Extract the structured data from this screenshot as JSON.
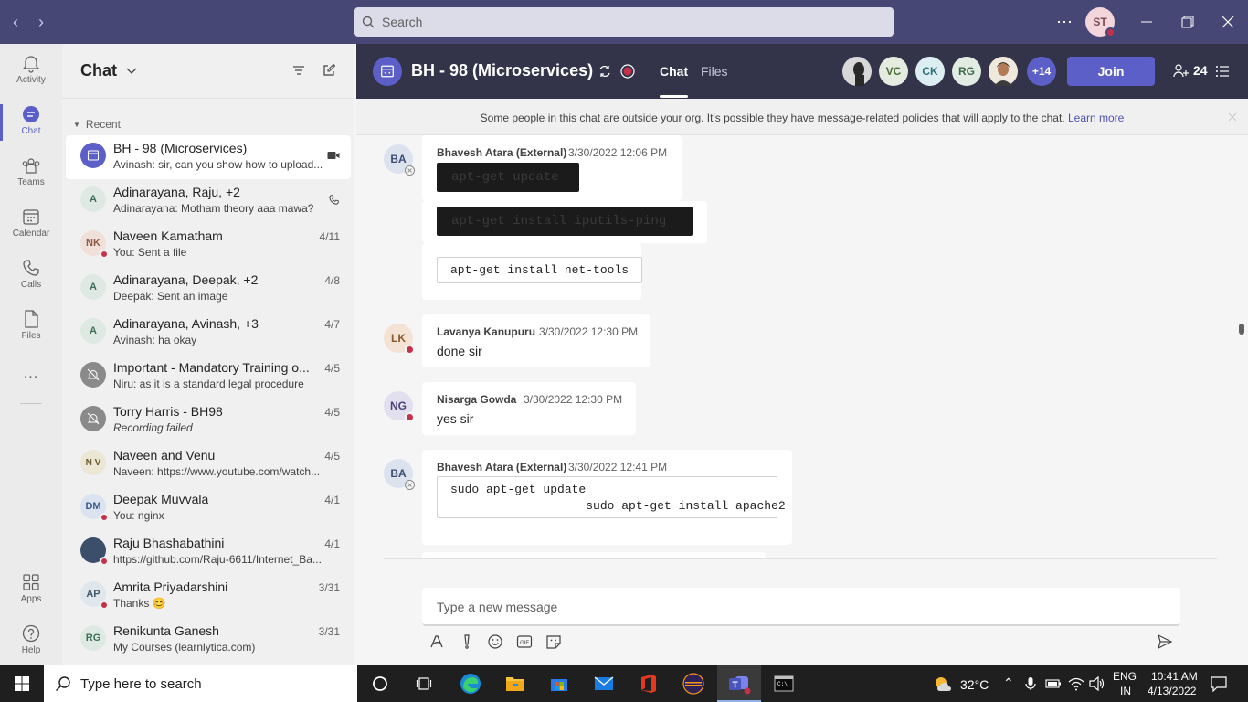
{
  "titlebar": {
    "search_placeholder": "Search",
    "user_initials": "ST"
  },
  "rail": {
    "items": [
      {
        "label": "Activity",
        "icon": "bell-icon"
      },
      {
        "label": "Chat",
        "icon": "chat-icon"
      },
      {
        "label": "Teams",
        "icon": "teams-icon"
      },
      {
        "label": "Calendar",
        "icon": "calendar-icon"
      },
      {
        "label": "Calls",
        "icon": "phone-icon"
      },
      {
        "label": "Files",
        "icon": "file-icon"
      },
      {
        "label": "Apps",
        "icon": "apps-icon"
      },
      {
        "label": "Help",
        "icon": "help-icon"
      }
    ],
    "more": "..."
  },
  "chatlist": {
    "title": "Chat",
    "recent_label": "Recent",
    "items": [
      {
        "name": "BH - 98 (Microservices)",
        "preview": "Avinash: sir, can you show how to upload...",
        "date": "",
        "avatar": ""
      },
      {
        "name": "Adinarayana, Raju, +2",
        "preview": "Adinarayana: Motham theory aaa mawa?",
        "date": "",
        "avatar": "A"
      },
      {
        "name": "Naveen Kamatham",
        "preview": "You: Sent a file",
        "date": "4/11",
        "avatar": "NK"
      },
      {
        "name": "Adinarayana, Deepak, +2",
        "preview": "Deepak: Sent an image",
        "date": "4/8",
        "avatar": "A"
      },
      {
        "name": "Adinarayana, Avinash, +3",
        "preview": "Avinash: ha okay",
        "date": "4/7",
        "avatar": "A"
      },
      {
        "name": "Important - Mandatory Training o...",
        "preview": "Niru: as it is a standard legal procedure",
        "date": "4/5",
        "avatar": ""
      },
      {
        "name": "Torry Harris - BH98",
        "preview": "Recording failed",
        "date": "4/5",
        "avatar": ""
      },
      {
        "name": "Naveen and Venu",
        "preview": "Naveen: https://www.youtube.com/watch...",
        "date": "4/5",
        "avatar": "N V"
      },
      {
        "name": "Deepak Muvvala",
        "preview": "You: nginx",
        "date": "4/1",
        "avatar": "DM"
      },
      {
        "name": "Raju Bhashabathini",
        "preview": "https://github.com/Raju-6611/Internet_Ba...",
        "date": "4/1",
        "avatar": ""
      },
      {
        "name": "Amrita Priyadarshini",
        "preview": "Thanks 😊",
        "date": "3/31",
        "avatar": "AP"
      },
      {
        "name": "Renikunta Ganesh",
        "preview": "My Courses (learnlytica.com)",
        "date": "3/31",
        "avatar": "RG"
      }
    ]
  },
  "header": {
    "title": "BH - 98 (Microservices)",
    "tabs": [
      "Chat",
      "Files"
    ],
    "participants": [
      "VC",
      "CK",
      "RG"
    ],
    "more_count": "+14",
    "join_label": "Join",
    "people_count": "24"
  },
  "banner": {
    "text": "Some people in this chat are outside your org. It's possible they have message-related policies that will apply to the chat.",
    "link": "Learn more"
  },
  "messages": [
    {
      "initials": "BA",
      "sender": "Bhavesh Atara (External)",
      "time": "3/30/2022 12:06 PM",
      "code1": "apt-get update",
      "code2": "apt-get install iputils-ping",
      "code3": "apt-get install net-tools"
    },
    {
      "initials": "LK",
      "sender": "Lavanya Kanupuru",
      "time": "3/30/2022 12:30 PM",
      "text": "done sir"
    },
    {
      "initials": "NG",
      "sender": "Nisarga Gowda",
      "time": "3/30/2022 12:30 PM",
      "text": "yes sir"
    },
    {
      "initials": "BA",
      "sender": "Bhavesh Atara (External)",
      "time": "3/30/2022 12:41 PM",
      "code": "sudo apt-get update\n                   sudo apt-get install apache2"
    }
  ],
  "compose": {
    "placeholder": "Type a new message"
  },
  "taskbar": {
    "search_placeholder": "Type here to search",
    "temperature": "32°C",
    "lang": "ENG",
    "region": "IN",
    "time": "10:41 AM",
    "date": "4/13/2022"
  },
  "colors": {
    "titlebar": "#464775",
    "accent": "#5b5fc7",
    "header": "#33344a",
    "status_busy": "#c4314b"
  }
}
